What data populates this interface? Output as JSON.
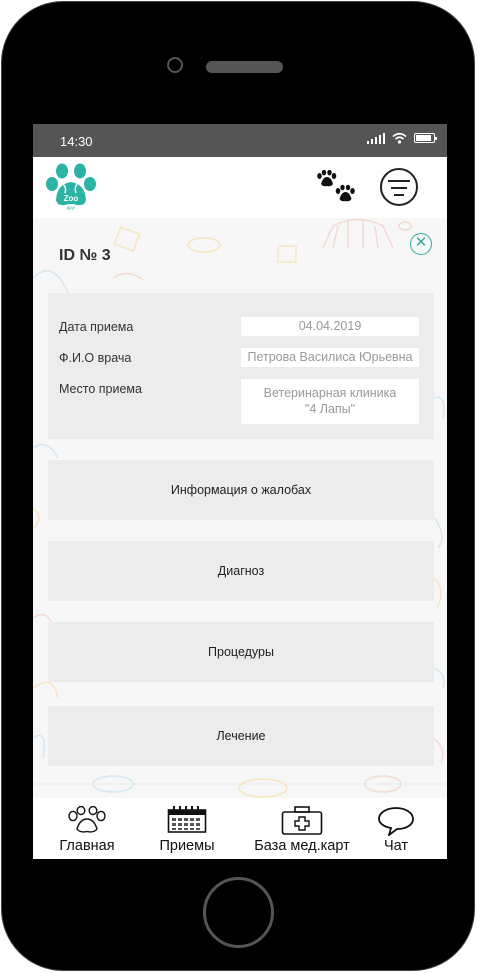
{
  "status": {
    "time": "14:30"
  },
  "header": {
    "logo_text": "Zoo",
    "logo_subtext": "друг"
  },
  "record": {
    "title": "ID № 3"
  },
  "info": {
    "date_label": "Дата приема",
    "date_value": "04.04.2019",
    "doctor_label": "Ф.И.О врача",
    "doctor_value": "Петрова Василиса Юрьевна",
    "place_label": "Место приема",
    "place_line1": "Ветеринарная клиника",
    "place_line2": "\"4 Лапы\""
  },
  "sections": [
    "Информация о жалобах",
    "Диагноз",
    "Процедуры",
    "Лечение"
  ],
  "tabs": [
    "Главная",
    "Приемы",
    "База мед.карт",
    "Чат"
  ],
  "colors": {
    "accent": "#33aaa0",
    "status_bar": "#555555",
    "card": "#ececec"
  }
}
